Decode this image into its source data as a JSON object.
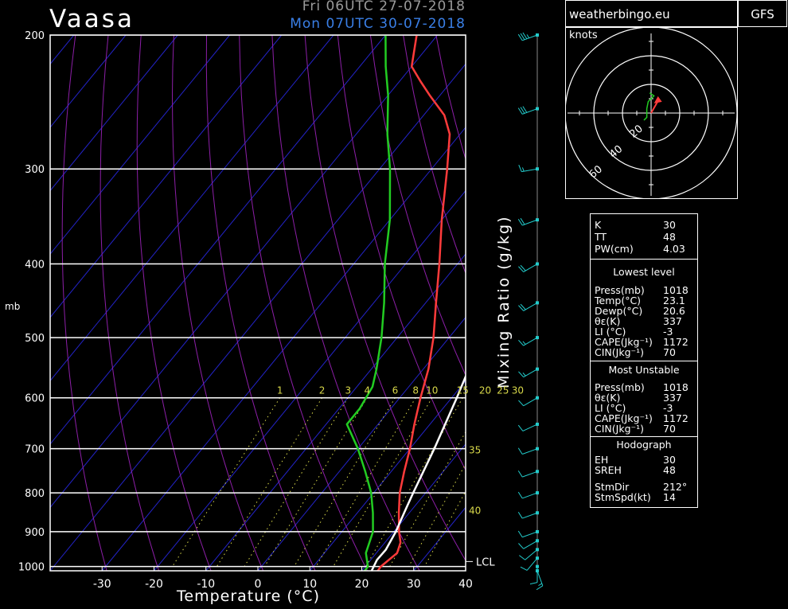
{
  "header": {
    "station": "Vaasa",
    "run_time": "Fri 06UTC 27-07-2018",
    "valid_time": "Mon 07UTC 30-07-2018",
    "site": "weatherbingo.eu",
    "model": "GFS"
  },
  "colors": {
    "temperature": "#ff3b3b",
    "dewpoint": "#22cc22",
    "parcel": "#ffffff",
    "isotherm": "#2323c8",
    "dry_adiabat": "#8d1fa8",
    "mixing_ratio": "#d9d94a",
    "wind": "#22cccc",
    "run_text": "#9a9a9a",
    "valid_text": "#3a7fe6"
  },
  "chart_data": {
    "type": "line",
    "chart_kind": "skew-T log-P sounding",
    "xlabel": "Temperature (°C)",
    "ylabel": "mb",
    "xlim": [
      -40,
      40
    ],
    "ylim": [
      1013,
      200
    ],
    "y_scale": "log",
    "x_ticks": [
      -30,
      -20,
      -10,
      0,
      10,
      20,
      30,
      40
    ],
    "pressure_levels": [
      200,
      300,
      400,
      500,
      600,
      700,
      800,
      900,
      1000
    ],
    "mixing_ratio_label": "Mixing Ratio (g/kg)",
    "mixing_ratio_lines": [
      "1",
      "2",
      "3",
      "4",
      "6",
      "8",
      "10",
      "15",
      "20",
      "25",
      "30"
    ],
    "side_labels": [
      "35",
      "40"
    ],
    "lcl_label": "LCL",
    "series": [
      {
        "name": "Temperature",
        "color": "#ff3b3b",
        "points": [
          [
            1018,
            23.1
          ],
          [
            1000,
            23
          ],
          [
            960,
            24
          ],
          [
            930,
            23
          ],
          [
            900,
            21
          ],
          [
            850,
            18
          ],
          [
            800,
            15
          ],
          [
            750,
            12.5
          ],
          [
            700,
            10
          ],
          [
            650,
            7
          ],
          [
            600,
            4
          ],
          [
            550,
            1
          ],
          [
            500,
            -3
          ],
          [
            450,
            -8
          ],
          [
            400,
            -13.5
          ],
          [
            350,
            -20
          ],
          [
            300,
            -27
          ],
          [
            270,
            -32
          ],
          [
            255,
            -36
          ],
          [
            240,
            -42
          ],
          [
            230,
            -46
          ],
          [
            220,
            -50
          ],
          [
            200,
            -54
          ]
        ]
      },
      {
        "name": "Dewpoint",
        "color": "#22cc22",
        "points": [
          [
            1018,
            20.6
          ],
          [
            1000,
            20.5
          ],
          [
            960,
            18
          ],
          [
            900,
            16
          ],
          [
            850,
            13
          ],
          [
            800,
            9.5
          ],
          [
            750,
            5
          ],
          [
            700,
            0
          ],
          [
            650,
            -6
          ],
          [
            620,
            -6
          ],
          [
            580,
            -7
          ],
          [
            550,
            -9
          ],
          [
            500,
            -13
          ],
          [
            450,
            -18
          ],
          [
            400,
            -24
          ],
          [
            350,
            -30
          ],
          [
            300,
            -38
          ],
          [
            270,
            -44
          ],
          [
            240,
            -50
          ],
          [
            220,
            -55
          ],
          [
            200,
            -60
          ]
        ]
      },
      {
        "name": "Parcel",
        "color": "#ffffff",
        "points": [
          [
            1018,
            22
          ],
          [
            980,
            21.2
          ],
          [
            950,
            21.3
          ],
          [
            900,
            20.4
          ],
          [
            850,
            19
          ],
          [
            800,
            17.6
          ],
          [
            700,
            14.7
          ],
          [
            600,
            11
          ],
          [
            500,
            6.3
          ],
          [
            450,
            3.3
          ],
          [
            400,
            -0.8
          ],
          [
            350,
            -6.3
          ],
          [
            300,
            -13.5
          ],
          [
            250,
            -23
          ],
          [
            220,
            -30
          ],
          [
            200,
            -36
          ]
        ]
      }
    ],
    "winds": [
      {
        "p": 200,
        "dir": 250,
        "spd": 35
      },
      {
        "p": 250,
        "dir": 250,
        "spd": 30
      },
      {
        "p": 300,
        "dir": 260,
        "spd": 18
      },
      {
        "p": 350,
        "dir": 250,
        "spd": 22
      },
      {
        "p": 400,
        "dir": 240,
        "spd": 20
      },
      {
        "p": 450,
        "dir": 240,
        "spd": 20
      },
      {
        "p": 500,
        "dir": 240,
        "spd": 18
      },
      {
        "p": 550,
        "dir": 240,
        "spd": 18
      },
      {
        "p": 600,
        "dir": 240,
        "spd": 14
      },
      {
        "p": 650,
        "dir": 245,
        "spd": 14
      },
      {
        "p": 700,
        "dir": 250,
        "spd": 12
      },
      {
        "p": 750,
        "dir": 250,
        "spd": 14
      },
      {
        "p": 800,
        "dir": 250,
        "spd": 12
      },
      {
        "p": 850,
        "dir": 250,
        "spd": 12
      },
      {
        "p": 900,
        "dir": 250,
        "spd": 10
      },
      {
        "p": 925,
        "dir": 240,
        "spd": 10
      },
      {
        "p": 950,
        "dir": 230,
        "spd": 10
      },
      {
        "p": 975,
        "dir": 220,
        "spd": 10
      },
      {
        "p": 1000,
        "dir": 180,
        "spd": 10
      },
      {
        "p": 1013,
        "dir": 160,
        "spd": 15
      }
    ],
    "hodograph": {
      "unit": "knots",
      "ring_labels": [
        "20",
        "40",
        "60"
      ],
      "trace": [
        [
          -5,
          -5
        ],
        [
          -3,
          -3
        ],
        [
          -3,
          3
        ],
        [
          -2,
          8
        ],
        [
          0,
          10
        ],
        [
          2,
          12
        ],
        [
          -1,
          14
        ]
      ],
      "storm_motion": [
        4,
        7
      ]
    }
  },
  "indices": {
    "top": [
      {
        "name": "K",
        "value": "30"
      },
      {
        "name": "TT",
        "value": "48"
      },
      {
        "name": "PW(cm)",
        "value": "4.03"
      }
    ],
    "lowest": {
      "heading": "Lowest level",
      "rows": [
        {
          "name": "Press(mb)",
          "value": "1018"
        },
        {
          "name": "Temp(°C)",
          "value": "23.1"
        },
        {
          "name": "Dewp(°C)",
          "value": "20.6"
        },
        {
          "name": "θε(K)",
          "value": "337"
        },
        {
          "name": "LI (°C)",
          "value": "-3"
        },
        {
          "name": "CAPE(Jkg⁻¹)",
          "value": "1172"
        },
        {
          "name": "CIN(Jkg⁻¹)",
          "value": "70"
        }
      ]
    },
    "unstable": {
      "heading": "Most Unstable",
      "rows": [
        {
          "name": "Press(mb)",
          "value": "1018"
        },
        {
          "name": "θε(K)",
          "value": "337"
        },
        {
          "name": "LI (°C)",
          "value": "-3"
        },
        {
          "name": "CAPE(Jkg⁻¹)",
          "value": "1172"
        },
        {
          "name": "CIN(Jkg⁻¹)",
          "value": "70"
        }
      ]
    },
    "hodo": {
      "heading": "Hodograph",
      "rows": [
        {
          "name": "EH",
          "value": "30"
        },
        {
          "name": "SREH",
          "value": "48"
        },
        {
          "name": "StmDir",
          "value": "212°"
        },
        {
          "name": "StmSpd(kt)",
          "value": "14"
        }
      ]
    }
  }
}
